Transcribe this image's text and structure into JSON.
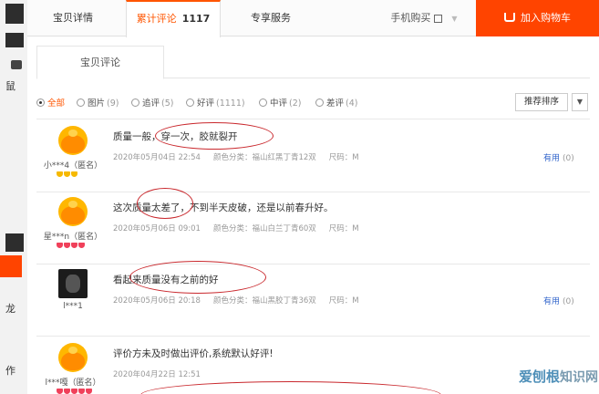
{
  "left_strip": {
    "chars": [
      "鼠",
      "龙",
      "作"
    ]
  },
  "tabs": {
    "details": "宝贝详情",
    "reviews": "累计评论",
    "reviews_count": "1117",
    "service": "专享服务",
    "mobile": "手机购买"
  },
  "cart_button": "加入购物车",
  "subtab": "宝贝评论",
  "filters": [
    {
      "label": "全部",
      "count": "",
      "checked": true
    },
    {
      "label": "图片",
      "count": "(9)",
      "checked": false
    },
    {
      "label": "追评",
      "count": "(5)",
      "checked": false
    },
    {
      "label": "好评",
      "count": "(1111)",
      "checked": false
    },
    {
      "label": "中评",
      "count": "(2)",
      "checked": false
    },
    {
      "label": "差评",
      "count": "(4)",
      "checked": false
    }
  ],
  "sort": {
    "label": "推荐排序"
  },
  "reviews": [
    {
      "username": "小***4（匿名）",
      "avatar": "fox",
      "badge_color": "gold",
      "badge_count": 3,
      "text": "质量一般，穿一次，胶就裂开",
      "date": "2020年05月04日 22:54",
      "color_label": "颜色分类：福山红黑丁青12双",
      "size_label": "尺码：M",
      "useful_label": "有用",
      "useful_count": "(0)"
    },
    {
      "username": "星***n（匿名）",
      "avatar": "fox",
      "badge_color": "red",
      "badge_count": 4,
      "text": "这次质量太差了，不到半天皮破，还是以前春升好。",
      "date": "2020年05月06日 09:01",
      "color_label": "颜色分类：福山白兰丁青60双",
      "size_label": "尺码：M",
      "useful_label": "有用",
      "useful_count": "(0)"
    },
    {
      "username": "l***1",
      "avatar": "dark",
      "badge_color": "none",
      "badge_count": 0,
      "text": "看起来质量没有之前的好",
      "date": "2020年05月06日 20:18",
      "color_label": "颜色分类：福山黑胶丁青36双",
      "size_label": "尺码：M",
      "useful_label": "有用",
      "useful_count": "(0)"
    },
    {
      "username": "l***嘎（匿名）",
      "avatar": "fox",
      "badge_color": "red",
      "badge_count": 5,
      "text": "评价方未及时做出评价,系统默认好评!",
      "date": "2020年04月22日 12:51",
      "color_label": "",
      "size_label": "",
      "useful_label": "",
      "useful_count": ""
    }
  ],
  "watermark": {
    "cn": "爱刨根",
    "en": "知识网"
  },
  "colors": {
    "accent": "#ff5500",
    "cart": "#ff4400",
    "annotation": "#c9282d",
    "link": "#3366cc"
  }
}
